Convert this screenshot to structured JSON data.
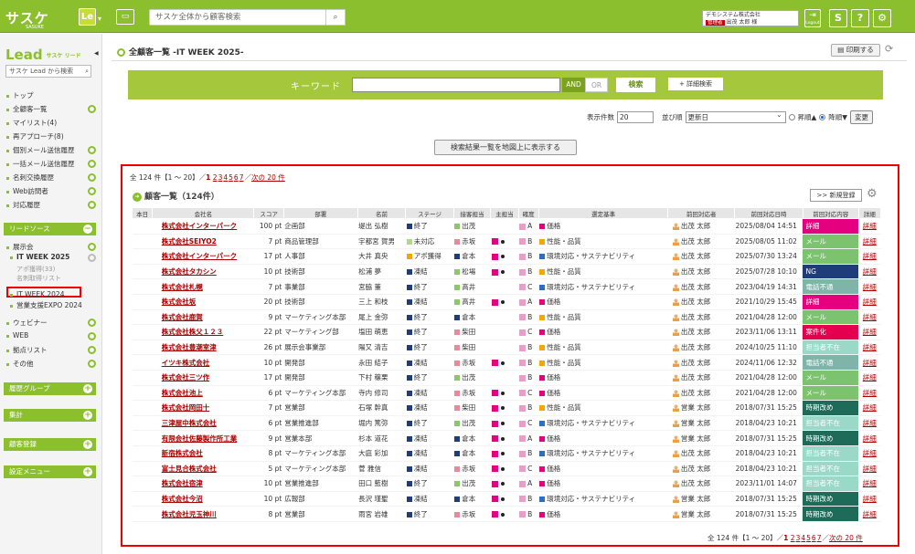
{
  "header": {
    "logo": "サスケ",
    "logo_sub": "SASUKE",
    "app_badge": "Le",
    "search_placeholder": "サスケ全体から顧客検索",
    "company": "デモシステム株式会社",
    "role": "管理者",
    "user": "出茂 太郎 様",
    "logout": "Logout",
    "help": "?"
  },
  "sidebar": {
    "logo": "Lead",
    "logo_sub": "サスケ リード",
    "search_placeholder": "サスケ Lead から検索",
    "items": [
      "トップ",
      "全顧客一覧",
      "マイリスト(4)",
      "再アプローチ(8)",
      "個別メール送信履歴",
      "一括メール送信履歴",
      "名刺交換履歴",
      "Web訪問者",
      "対応履歴"
    ],
    "lead_source": "リードソース",
    "events": "展示会",
    "event_active": "IT WEEK 2025",
    "event_sub1": "アポ獲得(33)",
    "event_sub2": "名刺取得リスト",
    "event2": "IT WEEK 2024",
    "event3": "営業支援EXPO 2024",
    "more": [
      "ウェビナー",
      "WEB",
      "拠点リスト",
      "その他"
    ],
    "groups": [
      "履歴グループ",
      "集計",
      "顧客登録",
      "設定メニュー"
    ]
  },
  "page": {
    "title": "全顧客一覧 -IT WEEK 2025-",
    "print": "印刷する"
  },
  "keyword": {
    "label": "キーワード",
    "and": "AND",
    "or": "OR",
    "search": "検索",
    "detail": "+ 詳細検索"
  },
  "display": {
    "count_label": "表示件数",
    "count": "20",
    "sort_label": "並び順",
    "sort": "更新日",
    "asc": "昇順▲",
    "desc": "降順▼",
    "change": "変更"
  },
  "map_button": "検索結果一覧を地図上に表示する",
  "pager": {
    "prefix": "全 124 件【1 ～ 20】／",
    "current": "1",
    "pages": [
      "2",
      "3",
      "4",
      "5",
      "6",
      "7"
    ],
    "next": "次の 20 件"
  },
  "list": {
    "title": "顧客一覧（124件）",
    "new_button": ">> 新規登録"
  },
  "columns": [
    "本日",
    "会社名",
    "スコア",
    "部署",
    "名前",
    "ステージ",
    "接客担当",
    "主担当",
    "確度",
    "選定基準",
    "前回対応者",
    "前回対応日時",
    "前回対応内容",
    "詳細"
  ],
  "rows": [
    {
      "co": "株式会社インターパーク",
      "score": "100 pt",
      "dept": "企画部",
      "name": "堤出 弘樹",
      "stage": "終了",
      "stc": "#1f3d7a",
      "host": "出茂",
      "hsc": "#8cc76e",
      "main": false,
      "rank": "A",
      "crit": "価格",
      "cc": "#e4007f",
      "prev": "出茂 太郎",
      "date": "2025/08/04 14:51",
      "cont": "詳細",
      "ccol": "#e4007f"
    },
    {
      "co": "株式会社SEIYO2",
      "score": "7 pt",
      "dept": "商品管理部",
      "name": "宇都宮 賀男",
      "stage": "未対応",
      "stc": "#b0d88a",
      "host": "赤坂",
      "hsc": "#e88a9a",
      "main": true,
      "rank": "B",
      "crit": "性能・品質",
      "cc": "#f5a700",
      "prev": "出茂 太郎",
      "date": "2025/08/05 11:02",
      "cont": "メール",
      "ccol": "#7cc36f"
    },
    {
      "co": "株式会社インターパーク",
      "score": "17 pt",
      "dept": "人事部",
      "name": "大井 真央",
      "stage": "アポ獲得",
      "stc": "#f5a700",
      "host": "倉本",
      "hsc": "#1f3d7a",
      "main": true,
      "rank": "B",
      "crit": "環境対応・サステナビリティ",
      "cc": "#2a6ec8",
      "prev": "出茂 太郎",
      "date": "2025/07/30 13:24",
      "cont": "メール",
      "ccol": "#7cc36f"
    },
    {
      "co": "株式会社タカシン",
      "score": "10 pt",
      "dept": "技術部",
      "name": "松浦 夢",
      "stage": "凍結",
      "stc": "#1f3d7a",
      "host": "松場",
      "hsc": "#8cc76e",
      "main": true,
      "rank": "B",
      "crit": "性能・品質",
      "cc": "#f5a700",
      "prev": "出茂 太郎",
      "date": "2025/07/28 10:10",
      "cont": "NG",
      "ccol": "#1f3d7a"
    },
    {
      "co": "株式会社札幌",
      "score": "7 pt",
      "dept": "事業部",
      "name": "宮脇 董",
      "stage": "終了",
      "stc": "#1f3d7a",
      "host": "高井",
      "hsc": "#8cc76e",
      "main": false,
      "rank": "C",
      "crit": "環境対応・サステナビリティ",
      "cc": "#2a6ec8",
      "prev": "出茂 太郎",
      "date": "2023/04/19 14:31",
      "cont": "電話不通",
      "ccol": "#7fb5a8"
    },
    {
      "co": "株式会社坂",
      "score": "20 pt",
      "dept": "技術部",
      "name": "三上 和枝",
      "stage": "凍結",
      "stc": "#1f3d7a",
      "host": "高井",
      "hsc": "#8cc76e",
      "main": true,
      "rank": "A",
      "crit": "価格",
      "cc": "#e4007f",
      "prev": "出茂 太郎",
      "date": "2021/10/29 15:45",
      "cont": "詳細",
      "ccol": "#e4007f"
    },
    {
      "co": "株式会社鹿賀",
      "score": "9 pt",
      "dept": "マーケティング本部",
      "name": "尾上 金弥",
      "stage": "終了",
      "stc": "#1f3d7a",
      "host": "倉本",
      "hsc": "#1f3d7a",
      "main": false,
      "rank": "B",
      "crit": "性能・品質",
      "cc": "#f5a700",
      "prev": "出茂 太郎",
      "date": "2021/04/28 12:00",
      "cont": "メール",
      "ccol": "#7cc36f"
    },
    {
      "co": "株式会社株父１２３",
      "score": "22 pt",
      "dept": "マーケティング部",
      "name": "塩田 萌恵",
      "stage": "終了",
      "stc": "#1f3d7a",
      "host": "柴田",
      "hsc": "#e88a9a",
      "main": false,
      "rank": "C",
      "crit": "価格",
      "cc": "#e4007f",
      "prev": "出茂 太郎",
      "date": "2023/11/06 13:11",
      "cont": "案件化",
      "ccol": "#e4004f"
    },
    {
      "co": "株式会社豊潮室津",
      "score": "26 pt",
      "dept": "展示会事業部",
      "name": "陽又 清吉",
      "stage": "終了",
      "stc": "#1f3d7a",
      "host": "柴田",
      "hsc": "#e88a9a",
      "main": false,
      "rank": "B",
      "crit": "性能・品質",
      "cc": "#f5a700",
      "prev": "出茂 太郎",
      "date": "2024/10/25 11:10",
      "cont": "担当者不在",
      "ccol": "#9ad8c8"
    },
    {
      "co": "イツキ株式会社",
      "score": "10 pt",
      "dept": "開発部",
      "name": "永田 結子",
      "stage": "凍結",
      "stc": "#1f3d7a",
      "host": "赤坂",
      "hsc": "#e88a9a",
      "main": true,
      "rank": "B",
      "crit": "性能・品質",
      "cc": "#f5a700",
      "prev": "出茂 太郎",
      "date": "2024/11/06 12:32",
      "cont": "電話不通",
      "ccol": "#7fb5a8"
    },
    {
      "co": "株式会社三ツ作",
      "score": "17 pt",
      "dept": "開発部",
      "name": "下村 穣栗",
      "stage": "終了",
      "stc": "#1f3d7a",
      "host": "出茂",
      "hsc": "#8cc76e",
      "main": false,
      "rank": "B",
      "crit": "価格",
      "cc": "#e4007f",
      "prev": "出茂 太郎",
      "date": "2021/04/28 12:00",
      "cont": "メール",
      "ccol": "#7cc36f"
    },
    {
      "co": "株式会社池上",
      "score": "6 pt",
      "dept": "マーケティング本部",
      "name": "寺内 修司",
      "stage": "凍結",
      "stc": "#1f3d7a",
      "host": "赤坂",
      "hsc": "#e88a9a",
      "main": true,
      "rank": "C",
      "crit": "価格",
      "cc": "#e4007f",
      "prev": "出茂 太郎",
      "date": "2021/04/28 12:00",
      "cont": "メール",
      "ccol": "#7cc36f"
    },
    {
      "co": "株式会社岡田十",
      "score": "7 pt",
      "dept": "営業部",
      "name": "石塚 幹真",
      "stage": "凍結",
      "stc": "#1f3d7a",
      "host": "柴田",
      "hsc": "#e88a9a",
      "main": true,
      "rank": "B",
      "crit": "性能・品質",
      "cc": "#f5a700",
      "prev": "営業 太郎",
      "date": "2018/07/31 15:25",
      "cont": "時期改め",
      "ccol": "#1e6b5a"
    },
    {
      "co": "三津屋中株式会社",
      "score": "6 pt",
      "dept": "営業推進部",
      "name": "堀内 篤弥",
      "stage": "終了",
      "stc": "#1f3d7a",
      "host": "出茂",
      "hsc": "#8cc76e",
      "main": true,
      "rank": "C",
      "crit": "環境対応・サステナビリティ",
      "cc": "#2a6ec8",
      "prev": "営業 太郎",
      "date": "2018/04/23 10:21",
      "cont": "担当者不在",
      "ccol": "#9ad8c8"
    },
    {
      "co": "有限会社佐藤製作所工業",
      "score": "9 pt",
      "dept": "営業本部",
      "name": "杉本 道花",
      "stage": "凍結",
      "stc": "#1f3d7a",
      "host": "倉本",
      "hsc": "#1f3d7a",
      "main": true,
      "rank": "A",
      "crit": "価格",
      "cc": "#e4007f",
      "prev": "営業 太郎",
      "date": "2018/07/31 15:25",
      "cont": "時期改め",
      "ccol": "#1e6b5a"
    },
    {
      "co": "新宿株式会社",
      "score": "8 pt",
      "dept": "マーケティング本部",
      "name": "大庭 彩加",
      "stage": "凍結",
      "stc": "#1f3d7a",
      "host": "倉本",
      "hsc": "#1f3d7a",
      "main": true,
      "rank": "B",
      "crit": "環境対応・サステナビリティ",
      "cc": "#2a6ec8",
      "prev": "出茂 太郎",
      "date": "2018/04/23 10:21",
      "cont": "担当者不在",
      "ccol": "#9ad8c8"
    },
    {
      "co": "富士見合株式会社",
      "score": "5 pt",
      "dept": "マーケティング本部",
      "name": "菅 雅信",
      "stage": "凍結",
      "stc": "#1f3d7a",
      "host": "赤坂",
      "hsc": "#e88a9a",
      "main": true,
      "rank": "C",
      "crit": "価格",
      "cc": "#e4007f",
      "prev": "出茂 太郎",
      "date": "2018/04/23 10:21",
      "cont": "担当者不在",
      "ccol": "#9ad8c8"
    },
    {
      "co": "株式会社宿津",
      "score": "10 pt",
      "dept": "営業推進部",
      "name": "田口 藍樹",
      "stage": "終了",
      "stc": "#1f3d7a",
      "host": "出茂",
      "hsc": "#8cc76e",
      "main": true,
      "rank": "A",
      "crit": "価格",
      "cc": "#e4007f",
      "prev": "出茂 太郎",
      "date": "2023/11/01 14:07",
      "cont": "担当者不在",
      "ccol": "#9ad8c8"
    },
    {
      "co": "株式会社今沼",
      "score": "10 pt",
      "dept": "広報部",
      "name": "長沢 瑾聖",
      "stage": "凍結",
      "stc": "#1f3d7a",
      "host": "倉本",
      "hsc": "#1f3d7a",
      "main": true,
      "rank": "B",
      "crit": "環境対応・サステナビリティ",
      "cc": "#2a6ec8",
      "prev": "営業 太郎",
      "date": "2018/07/31 15:25",
      "cont": "時期改め",
      "ccol": "#1e6b5a"
    },
    {
      "co": "株式会社児玉神川",
      "score": "8 pt",
      "dept": "営業部",
      "name": "雨宮 岩雄",
      "stage": "終了",
      "stc": "#1f3d7a",
      "host": "赤坂",
      "hsc": "#e88a9a",
      "main": true,
      "rank": "B",
      "crit": "価格",
      "cc": "#e4007f",
      "prev": "営業 太郎",
      "date": "2018/07/31 15:25",
      "cont": "時期改め",
      "ccol": "#1e6b5a"
    }
  ]
}
